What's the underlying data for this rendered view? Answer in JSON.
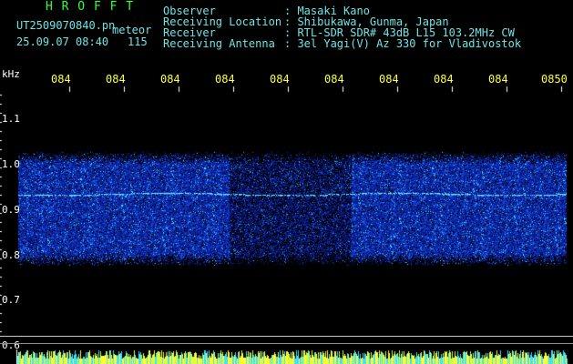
{
  "header": {
    "logo": "H R O F F T",
    "filename": "UT2509070840.pn",
    "meteor_label": "meteor",
    "date_time": "25.09.07 08:40",
    "meteor_count": "115"
  },
  "info": {
    "observer_label": "Observer",
    "observer_value": ": Masaki Kano",
    "location_label": "Receiving Location",
    "location_value": ": Shibukawa, Gunma, Japan",
    "receiver_label": "Receiver",
    "receiver_value": ": RTL-SDR SDR# 43dB L15 103.2MHz CW",
    "antenna_label": "Receiving Antenna",
    "antenna_value": ": 3el Yagi(V) Az 330 for Vladivostok"
  },
  "y_axis": {
    "unit": "kHz",
    "ticks": [
      "1.1",
      "1.0",
      "0.9",
      "0.8",
      "0.7",
      "0.6"
    ]
  },
  "x_axis": {
    "ticks": [
      "084",
      "084",
      "084",
      "084",
      "084",
      "084",
      "084",
      "084",
      "084",
      "0850"
    ]
  },
  "colors": {
    "background": "#000000",
    "noise_low": "#0a1a8c",
    "noise_high": "#2aa0ff",
    "axis_labels": "#ffff40",
    "logo": "#33ff33",
    "info_text": "#6fe3e3"
  }
}
